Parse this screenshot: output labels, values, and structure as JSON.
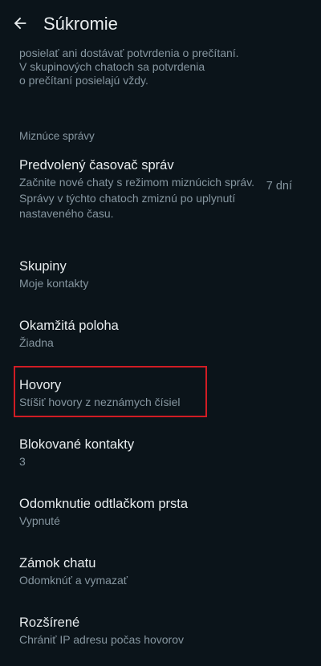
{
  "header": {
    "title": "Súkromie"
  },
  "read_receipts_partial": {
    "text_line1": "posielať ani dostávať potvrdenia o prečítaní.",
    "text_line2": "V skupinových chatoch sa potvrdenia",
    "text_line3": "o prečítaní posielajú vždy."
  },
  "disappearing": {
    "section_title": "Miznúce správy",
    "timer_title": "Predvolený časovač správ",
    "timer_desc": "Začnite nové chaty s režimom miznúcich správ. Správy v týchto chatoch zmiznú po uplynutí nastaveného času.",
    "timer_value": "7 dní"
  },
  "items": [
    {
      "title": "Skupiny",
      "sub": "Moje kontakty"
    },
    {
      "title": "Okamžitá poloha",
      "sub": "Žiadna"
    },
    {
      "title": "Hovory",
      "sub": "Stíšiť hovory z neznámych čísiel"
    },
    {
      "title": "Blokované kontakty",
      "sub": "3"
    },
    {
      "title": "Odomknutie odtlačkom prsta",
      "sub": "Vypnuté"
    },
    {
      "title": "Zámok chatu",
      "sub": "Odomknúť a vymazať"
    },
    {
      "title": "Rozšírené",
      "sub": "Chrániť IP adresu počas hovorov"
    }
  ],
  "colors": {
    "background": "#0b141a",
    "primary_text": "#e9edef",
    "secondary_text": "#8696a0",
    "highlight": "#d11c24"
  }
}
